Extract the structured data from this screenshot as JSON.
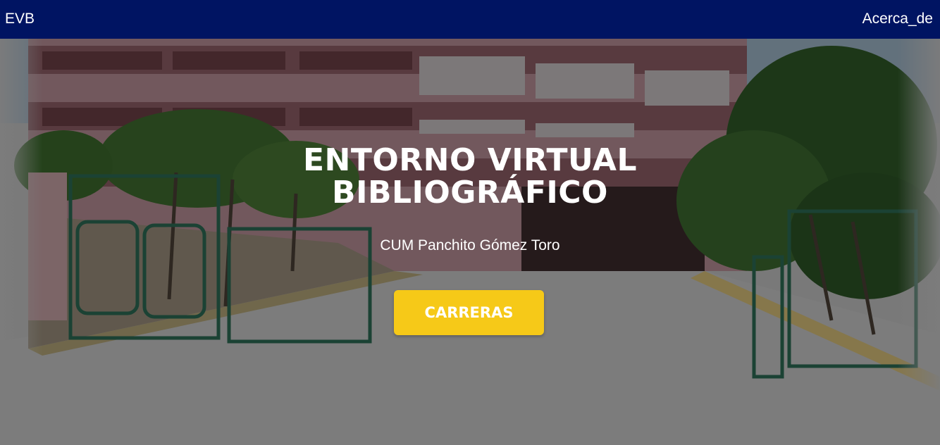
{
  "navbar": {
    "brand": "EVB",
    "link_about": "Acerca_de",
    "background": "#001462"
  },
  "hero": {
    "title_line1": "ENTORNO VIRTUAL",
    "title_line2": "BIBLIOGRÁFICO",
    "subtitle": "CUM Panchito Gómez Toro",
    "button_label": "CARRERAS",
    "button_color": "#f6c918"
  }
}
